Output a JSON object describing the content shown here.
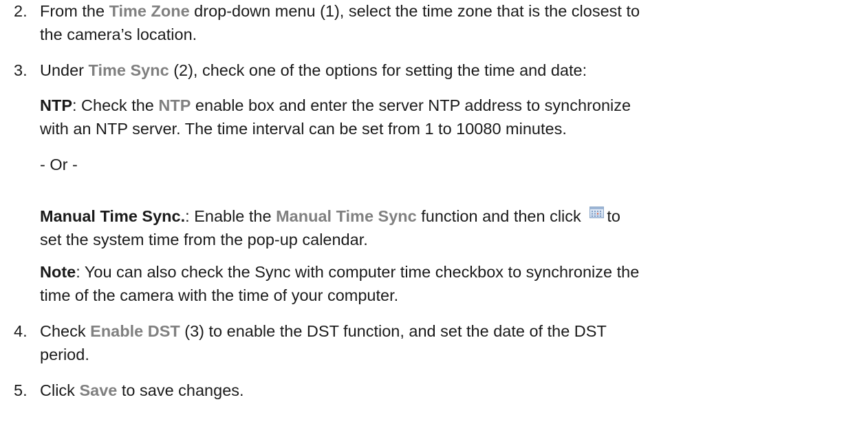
{
  "step2": {
    "number": "2.",
    "pre": "From the ",
    "menu": "Time Zone",
    "post_line1": " drop-down menu (1), select the time zone that is the closest to",
    "line2": "the camera’s location."
  },
  "step3": {
    "number": "3.",
    "pre": "Under ",
    "label": "Time Sync",
    "post": " (2), check one of the options for setting the time and date:",
    "ntp": {
      "heading": "NTP",
      "colon": ": Check the ",
      "label": "NTP",
      "line1_rest": " enable box and enter the server NTP address to synchronize",
      "line2": "with an NTP server. The time interval can be set from 1 to 10080 minutes."
    },
    "or": "- Or -",
    "manual": {
      "heading": "Manual Time Sync.",
      "colon": ": Enable the ",
      "label": "Manual Time Sync",
      "mid": " function and then click ",
      "icon": "calendar-icon",
      "end": "to",
      "line2": "set the system time from the pop-up calendar."
    },
    "note": {
      "heading": "Note",
      "line1": ": You can also check the Sync with computer time checkbox to synchronize the",
      "line2": "time of the camera with the time of your computer."
    }
  },
  "step4": {
    "number": "4.",
    "pre": "Check ",
    "label": "Enable DST",
    "post": " (3) to enable the DST function, and set the date of the DST",
    "line2": "period."
  },
  "step5": {
    "number": "5.",
    "pre": "Click ",
    "label": "Save",
    "post": " to save changes."
  },
  "colors": {
    "text": "#1a1a1a",
    "ui_label": "#808080"
  }
}
